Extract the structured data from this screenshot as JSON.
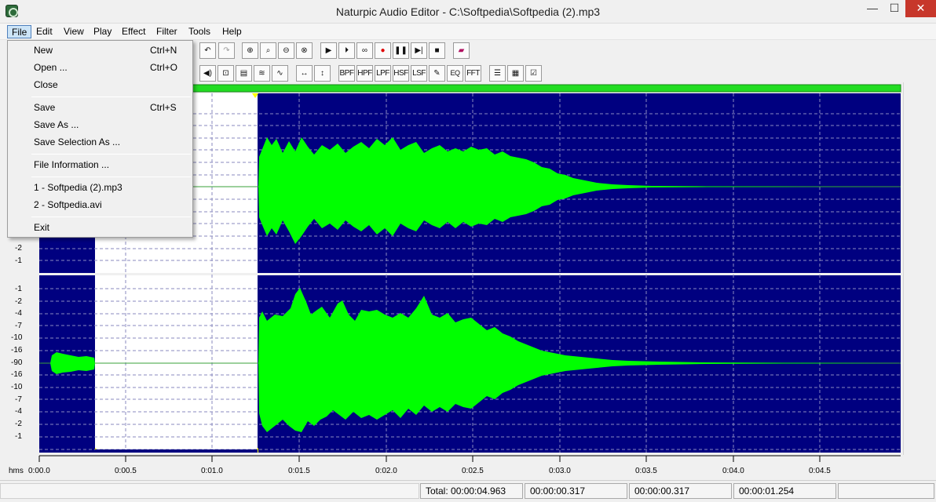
{
  "window": {
    "title": "Naturpic Audio Editor - C:\\Softpedia\\Softpedia (2).mp3",
    "minimize_glyph": "—",
    "maximize_glyph": "☐",
    "close_glyph": "✕"
  },
  "menubar": {
    "items": [
      {
        "label": "File"
      },
      {
        "label": "Edit"
      },
      {
        "label": "View"
      },
      {
        "label": "Play"
      },
      {
        "label": "Effect"
      },
      {
        "label": "Filter"
      },
      {
        "label": "Tools"
      },
      {
        "label": "Help"
      }
    ],
    "active": "File"
  },
  "file_menu": {
    "items": [
      {
        "label": "New",
        "shortcut": "Ctrl+N"
      },
      {
        "label": "Open ...",
        "shortcut": "Ctrl+O"
      },
      {
        "label": "Close",
        "shortcut": ""
      },
      {
        "label": "Save",
        "shortcut": "Ctrl+S"
      },
      {
        "label": "Save As ...",
        "shortcut": ""
      },
      {
        "label": "Save Selection As ...",
        "shortcut": ""
      },
      {
        "label": "File Information ...",
        "shortcut": ""
      },
      {
        "label": "1 - Softpedia (2).mp3",
        "shortcut": ""
      },
      {
        "label": "2 - Softpedia.avi",
        "shortcut": ""
      },
      {
        "label": "Exit",
        "shortcut": ""
      }
    ]
  },
  "toolbar": {
    "row1": [
      "undo-icon",
      "redo-icon",
      "zoom-in-icon",
      "zoom-selection-icon",
      "zoom-out-icon",
      "zoom-fit-icon",
      "play-icon",
      "play-selection-icon",
      "loop-icon",
      "record-icon",
      "pause-icon",
      "play-next-icon",
      "stop-icon",
      "book-icon"
    ],
    "row2_labels": {
      "bpf": "BPF",
      "hpf": "HPF",
      "lpf": "LPF",
      "hsf": "HSF",
      "lsf": "LSF",
      "eq": "EQ",
      "fft": "FFT"
    }
  },
  "waveform": {
    "bg_color": "#000080",
    "wave_color": "#00ff00",
    "selection_color": "#ffffff",
    "overview_color": "#00dd00",
    "top_channel_labels": [
      "-2",
      "-1"
    ],
    "bottom_channel_labels": [
      "-1",
      "-2",
      "-4",
      "-7",
      "-10",
      "-16",
      "-90",
      "-16",
      "-10",
      "-7",
      "-4",
      "-2",
      "-1"
    ]
  },
  "timeline": {
    "unit_label": "hms",
    "ticks": [
      "0:00.0",
      "0:00.5",
      "0:01.0",
      "0:01.5",
      "0:02.0",
      "0:02.5",
      "0:03.0",
      "0:03.5",
      "0:04.0",
      "0:04.5"
    ]
  },
  "status": {
    "total": "Total: 00:00:04.963",
    "sel_start": "00:00:00.317",
    "sel_end": "00:00:00.317",
    "sel_length": "00:00:01.254"
  },
  "colors": {
    "accent_menu": "#cce4f7",
    "close_button": "#c7372b"
  }
}
